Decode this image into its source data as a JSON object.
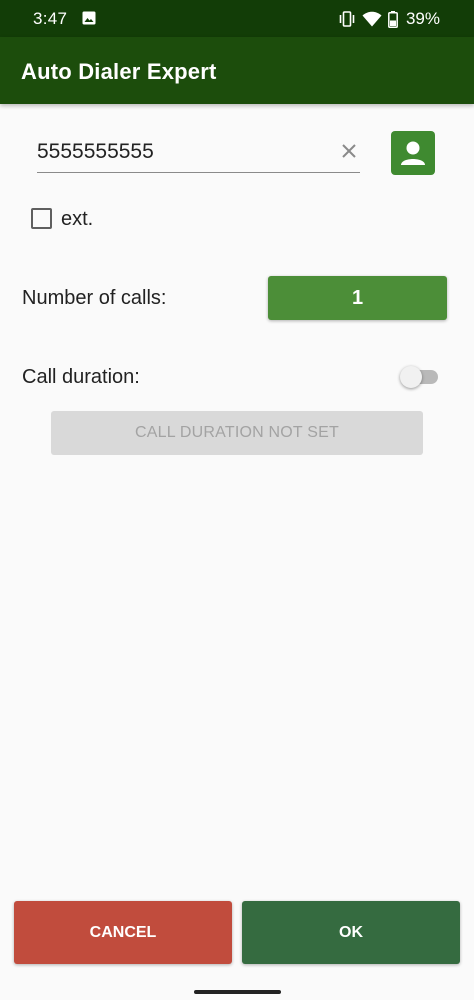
{
  "status_bar": {
    "time": "3:47",
    "battery": "39%",
    "icons": [
      "image-icon",
      "vibrate-icon",
      "wifi-icon",
      "battery-icon"
    ]
  },
  "app_bar": {
    "title": "Auto Dialer Expert",
    "color": "#1c4d0c"
  },
  "phone": {
    "value": "5555555555",
    "placeholder": ""
  },
  "ext": {
    "label": "ext.",
    "checked": false
  },
  "calls": {
    "label": "Number of calls:",
    "value": "1"
  },
  "duration": {
    "label": "Call duration:",
    "enabled": false,
    "button_label": "CALL DURATION NOT SET"
  },
  "actions": {
    "cancel_label": "CANCEL",
    "ok_label": "OK"
  },
  "colors": {
    "accent": "#4c8e38",
    "cancel": "#c14c3d",
    "ok": "#356b40"
  }
}
